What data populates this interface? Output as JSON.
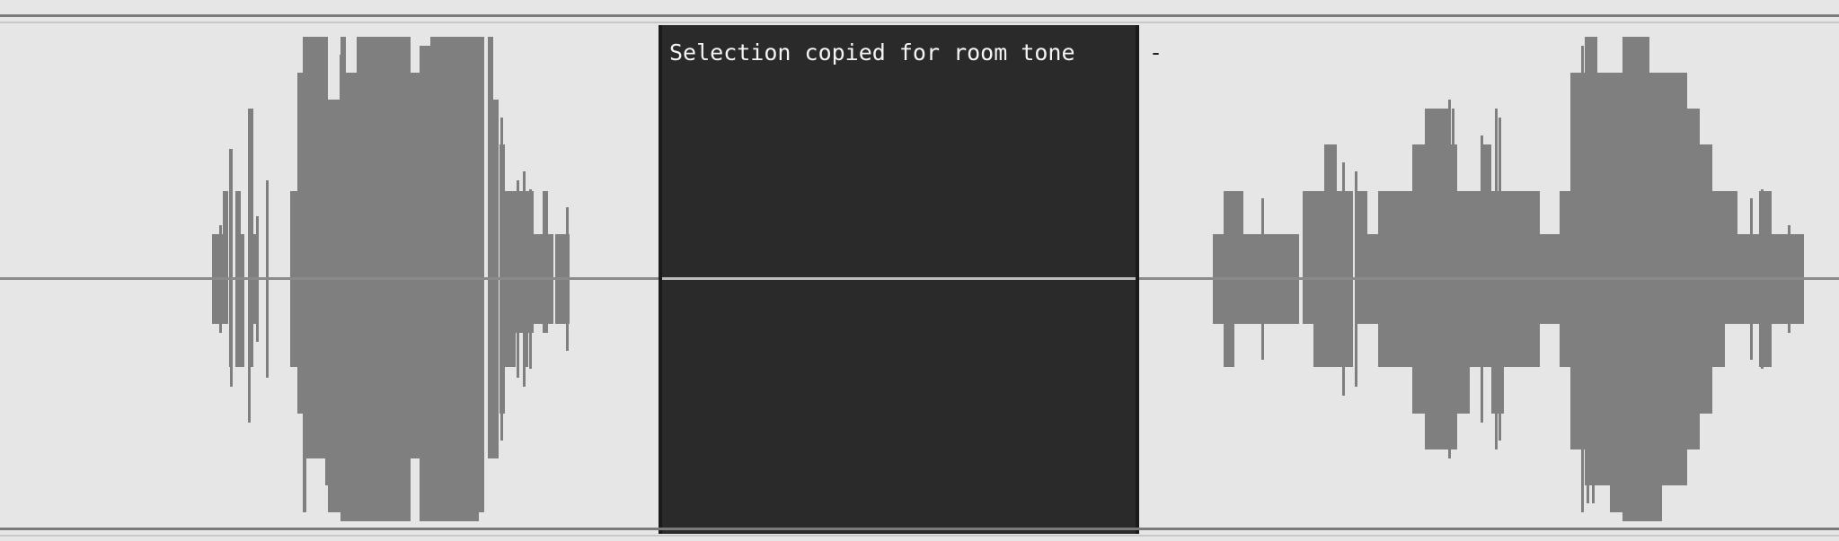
{
  "selection": {
    "label": "Selection copied for room tone"
  },
  "cursor_text": "-",
  "colors": {
    "background": "#e6e6e6",
    "waveform": "#7f7f7f",
    "selection_fill": "#2a2a2a",
    "selection_text": "#f4f4f4"
  }
}
